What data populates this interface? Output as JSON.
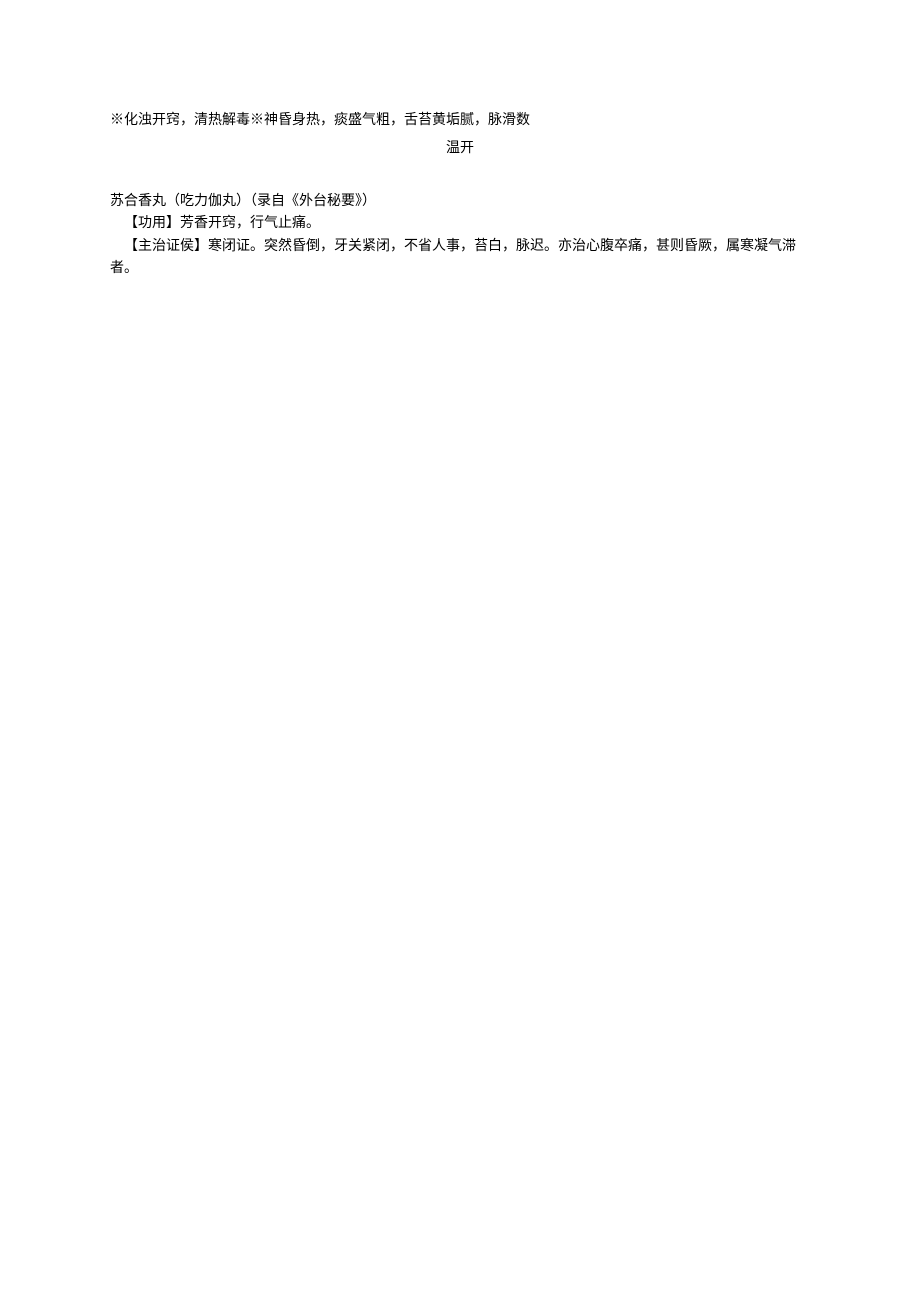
{
  "block1": "※化浊开窍，清热解毒※神昏身热，痰盛气粗，舌苔黄垢腻，脉滑数",
  "heading": "温开",
  "block2": {
    "title": "苏合香丸（吃力伽丸）（录自《外台秘要》）",
    "function": "【功用】芳香开窍，行气止痛。",
    "indication": "【主治证侯】寒闭证。突然昏倒，牙关紧闭，不省人事，苔白，脉迟。亦治心腹卒痛，甚则昏厥，属寒凝气滞者。"
  }
}
